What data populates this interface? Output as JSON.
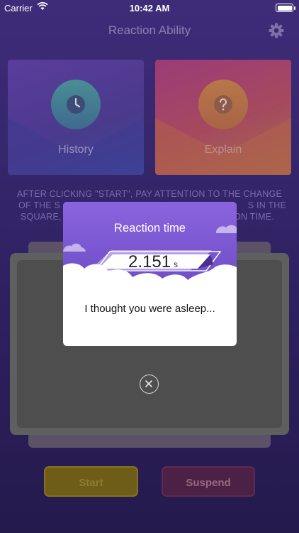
{
  "status_bar": {
    "carrier": "Carrier",
    "time": "10:42 AM"
  },
  "nav": {
    "title": "Reaction Ability",
    "settings_icon": "gear-icon"
  },
  "tiles": {
    "history": {
      "label": "History",
      "icon": "clock-icon"
    },
    "explain": {
      "label": "Explain",
      "icon": "question-icon"
    }
  },
  "instructions": {
    "line1": "AFTER CLICKING \"START\", PAY ATTENTION TO THE CHANGE",
    "line2": "OF THE S",
    "line2_end": "S IN THE",
    "line3": "SQUARE,",
    "line3_end": "ON TIME."
  },
  "buttons": {
    "start": "Start",
    "suspend": "Suspend"
  },
  "modal": {
    "title": "Reaction time",
    "time_value": "2.151",
    "time_unit": "s",
    "message": "I thought you were asleep..."
  },
  "colors": {
    "background": "#2e2160",
    "modal_header": "#7a57d4",
    "start_button": "#6e5c19",
    "suspend_button": "#4b2145"
  }
}
